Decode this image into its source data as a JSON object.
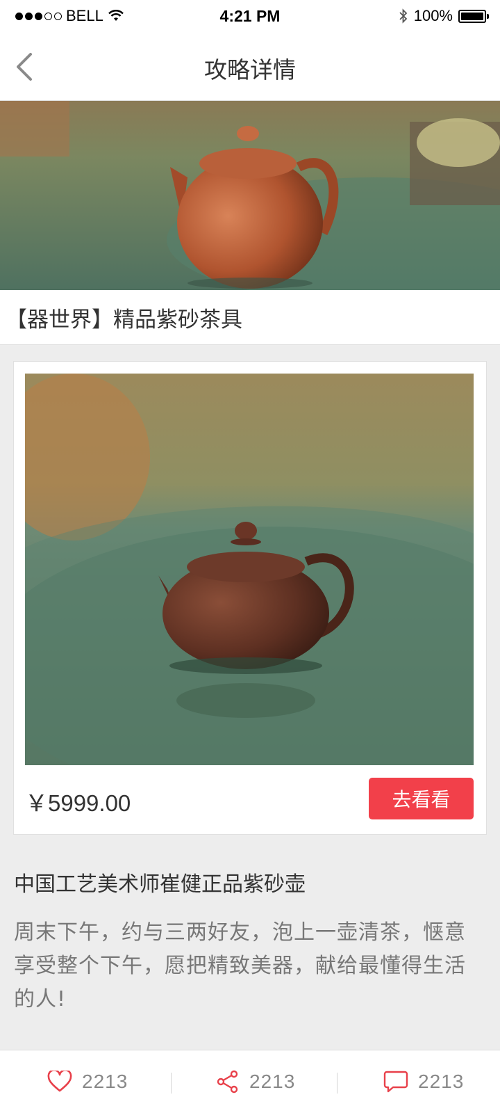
{
  "status_bar": {
    "carrier": "BELL",
    "time": "4:21 PM",
    "battery": "100%"
  },
  "nav": {
    "title": "攻略详情"
  },
  "hero": {
    "caption": "【器世界】精品紫砂茶具"
  },
  "product": {
    "price": "￥5999.00",
    "button_label": "去看看"
  },
  "article": {
    "title": "中国工艺美术师崔健正品紫砂壶",
    "description": "周末下午，约与三两好友，泡上一壶清茶，惬意享受整个下午，愿把精致美器，献给最懂得生活的人!"
  },
  "actions": {
    "likes": "2213",
    "shares": "2213",
    "comments": "2213"
  },
  "colors": {
    "accent": "#f2404a",
    "icon_red": "#e8404a",
    "background": "#ededed"
  },
  "icons": [
    "back-chevron-icon",
    "wifi-icon",
    "bluetooth-icon",
    "battery-icon",
    "heart-icon",
    "share-icon",
    "comment-icon"
  ]
}
